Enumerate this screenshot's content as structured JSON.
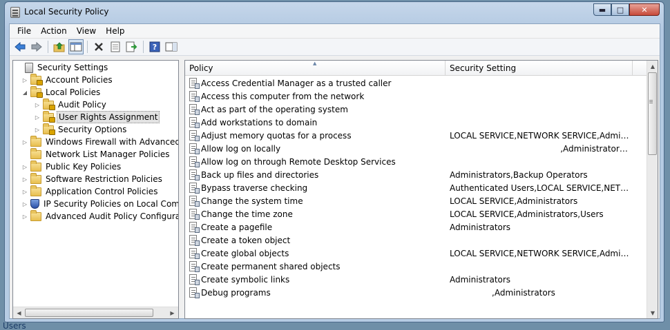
{
  "window": {
    "title": "Local Security Policy"
  },
  "caption": {
    "minimize": "▬",
    "maximize": "□",
    "close": "✕"
  },
  "menu": [
    "File",
    "Action",
    "View",
    "Help"
  ],
  "toolbar": {
    "icons": [
      "back-icon",
      "forward-icon",
      "up-folder-icon",
      "show-hide-tree-icon",
      "delete-icon",
      "properties-icon",
      "export-list-icon",
      "help-icon",
      "show-action-pane-icon"
    ]
  },
  "tree": [
    {
      "label": "Security Settings",
      "icon": "security-settings-icon",
      "expander": ""
    },
    {
      "label": "Account Policies",
      "icon": "locked-folder-icon",
      "expander": "▷"
    },
    {
      "label": "Local Policies",
      "icon": "locked-folder-icon",
      "expander": "◢"
    },
    {
      "label": "Audit Policy",
      "icon": "locked-folder-icon",
      "expander": "▷"
    },
    {
      "label": "User Rights Assignment",
      "icon": "locked-folder-icon",
      "expander": "▷",
      "selected": true
    },
    {
      "label": "Security Options",
      "icon": "locked-folder-icon",
      "expander": "▷"
    },
    {
      "label": "Windows Firewall with Advanced Secu",
      "icon": "folder-icon",
      "expander": "▷"
    },
    {
      "label": "Network List Manager Policies",
      "icon": "folder-icon",
      "expander": ""
    },
    {
      "label": "Public Key Policies",
      "icon": "folder-icon",
      "expander": "▷"
    },
    {
      "label": "Software Restriction Policies",
      "icon": "folder-icon",
      "expander": "▷"
    },
    {
      "label": "Application Control Policies",
      "icon": "folder-icon",
      "expander": "▷"
    },
    {
      "label": "IP Security Policies on Local Compute",
      "icon": "ip-security-icon",
      "expander": "▷"
    },
    {
      "label": "Advanced Audit Policy Configuration",
      "icon": "folder-icon",
      "expander": "▷"
    }
  ],
  "list": {
    "columns": [
      "Policy",
      "Security Setting"
    ],
    "sort_indicator": "▲",
    "rows": [
      {
        "policy": "Access Credential Manager as a trusted caller",
        "setting": ""
      },
      {
        "policy": "Access this computer from the network",
        "setting": ""
      },
      {
        "policy": "Act as part of the operating system",
        "setting": ""
      },
      {
        "policy": "Add workstations to domain",
        "setting": ""
      },
      {
        "policy": "Adjust memory quotas for a process",
        "setting": "LOCAL SERVICE,NETWORK SERVICE,Administra..."
      },
      {
        "policy": "Allow log on locally",
        "setting": "                                          ,Administrators,Users,Back..."
      },
      {
        "policy": "Allow log on through Remote Desktop Services",
        "setting": ""
      },
      {
        "policy": "Back up files and directories",
        "setting": "Administrators,Backup Operators"
      },
      {
        "policy": "Bypass traverse checking",
        "setting": "Authenticated Users,LOCAL SERVICE,NETWOR..."
      },
      {
        "policy": "Change the system time",
        "setting": "LOCAL SERVICE,Administrators"
      },
      {
        "policy": "Change the time zone",
        "setting": "LOCAL SERVICE,Administrators,Users"
      },
      {
        "policy": "Create a pagefile",
        "setting": "Administrators"
      },
      {
        "policy": "Create a token object",
        "setting": ""
      },
      {
        "policy": "Create global objects",
        "setting": "LOCAL SERVICE,NETWORK SERVICE,Administra..."
      },
      {
        "policy": "Create permanent shared objects",
        "setting": ""
      },
      {
        "policy": "Create symbolic links",
        "setting": "Administrators"
      },
      {
        "policy": "Debug programs",
        "setting": "                ,Administrators"
      }
    ]
  },
  "desktop": {
    "partial_label": "Users"
  }
}
